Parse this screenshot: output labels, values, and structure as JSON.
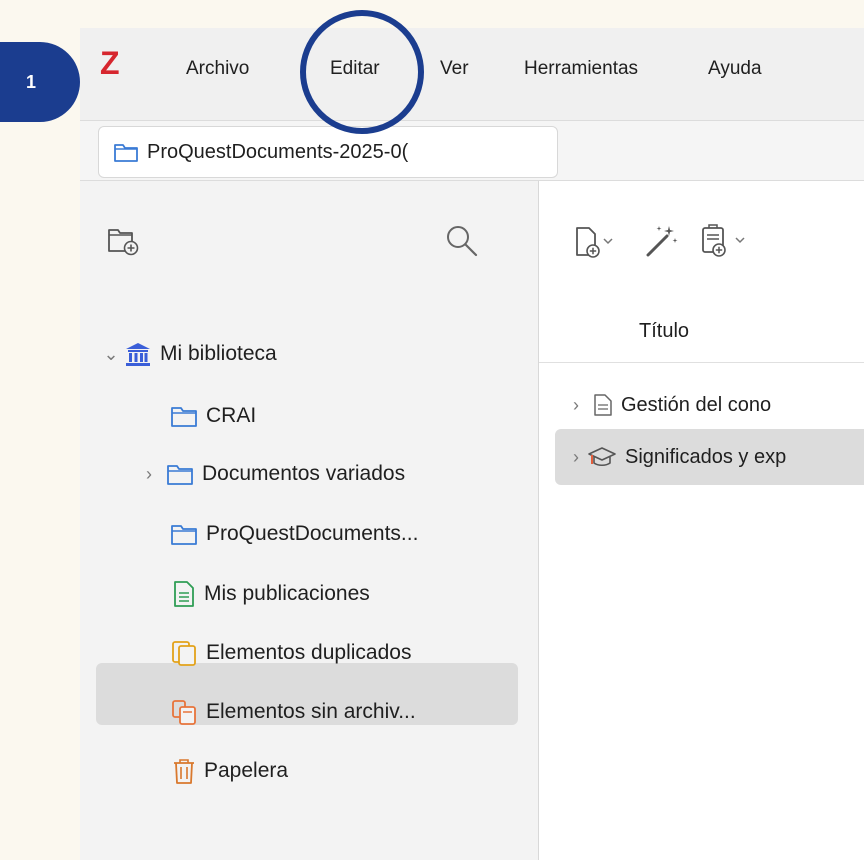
{
  "step": {
    "number": "1"
  },
  "app": {
    "logo_letter": "Z"
  },
  "menubar": {
    "items": [
      "Archivo",
      "Editar",
      "Ver",
      "Herramientas",
      "Ayuda"
    ],
    "highlighted": "Editar"
  },
  "tab": {
    "label": "ProQuestDocuments-2025-0("
  },
  "sidebar": {
    "tree": [
      {
        "label": "Mi biblioteca",
        "icon": "library-icon",
        "expanded": true
      },
      {
        "label": "CRAI",
        "icon": "folder-icon"
      },
      {
        "label": "Documentos variados",
        "icon": "folder-icon",
        "collapsed_children": true
      },
      {
        "label": "ProQuestDocuments...",
        "icon": "folder-icon",
        "selected": true
      },
      {
        "label": "Mis publicaciones",
        "icon": "publications-icon"
      },
      {
        "label": "Elementos duplicados",
        "icon": "duplicates-icon"
      },
      {
        "label": "Elementos sin archiv...",
        "icon": "unfiled-icon"
      },
      {
        "label": "Papelera",
        "icon": "trash-icon"
      }
    ]
  },
  "items_pane": {
    "column_header": "Título",
    "rows": [
      {
        "label": "Gestión del cono",
        "icon": "document-icon"
      },
      {
        "label": "Significados y exp",
        "icon": "thesis-icon",
        "selected": true
      }
    ]
  },
  "colors": {
    "accent": "#1b3d8f",
    "logo": "#d6262e",
    "folder": "#3a7bd5",
    "publications": "#2f9e55",
    "duplicates": "#e3a21a",
    "unfiled": "#e8743b",
    "trash": "#d9782d"
  }
}
